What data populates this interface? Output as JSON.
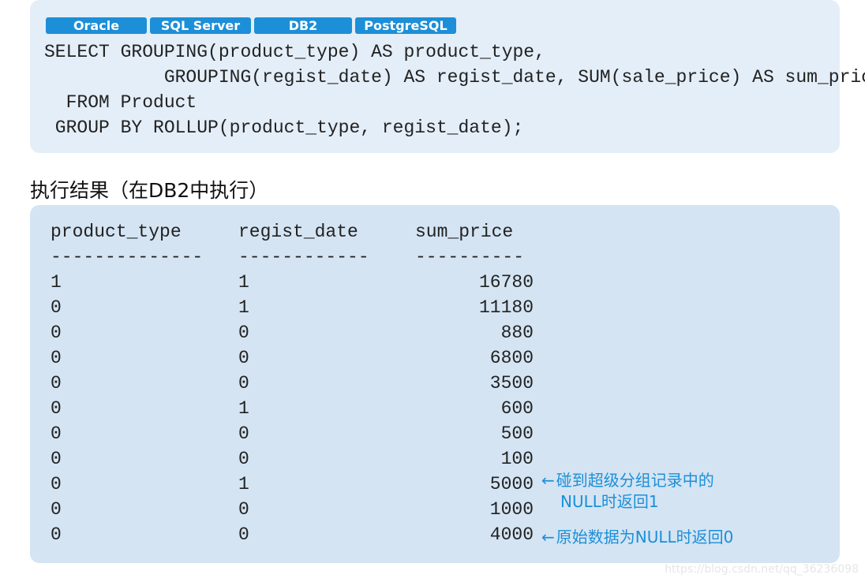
{
  "db_tags": [
    "Oracle",
    "SQL Server",
    "DB2",
    "PostgreSQL"
  ],
  "code_lines": [
    "SELECT GROUPING(product_type) AS product_type,",
    "           GROUPING(regist_date) AS regist_date, SUM(sale_price) AS sum_price",
    "  FROM Product",
    " GROUP BY ROLLUP(product_type, regist_date);"
  ],
  "result": {
    "heading": "执行结果（在DB2中执行）",
    "headers": [
      "product_type",
      "regist_date",
      "sum_price"
    ],
    "separators": [
      "--------------",
      "------------",
      "----------"
    ],
    "rows": [
      [
        "1",
        "1",
        "16780"
      ],
      [
        "0",
        "1",
        "11180"
      ],
      [
        "0",
        "0",
        "880"
      ],
      [
        "0",
        "0",
        "6800"
      ],
      [
        "0",
        "0",
        "3500"
      ],
      [
        "0",
        "1",
        "600"
      ],
      [
        "0",
        "0",
        "500"
      ],
      [
        "0",
        "0",
        "100"
      ],
      [
        "0",
        "1",
        "5000"
      ],
      [
        "0",
        "0",
        "1000"
      ],
      [
        "0",
        "0",
        "4000"
      ]
    ]
  },
  "annotations": {
    "arrow": "←",
    "super_group_line1": "碰到超级分组记录中的",
    "super_group_line2": "NULL时返回1",
    "original_null": "原始数据为NULL时返回0"
  },
  "watermark": "https://blog.csdn.net/qq_36236098",
  "colors": {
    "accent": "#1c8fd8",
    "code_panel_bg": "#e4eef8",
    "result_panel_bg": "#d4e4f3"
  }
}
